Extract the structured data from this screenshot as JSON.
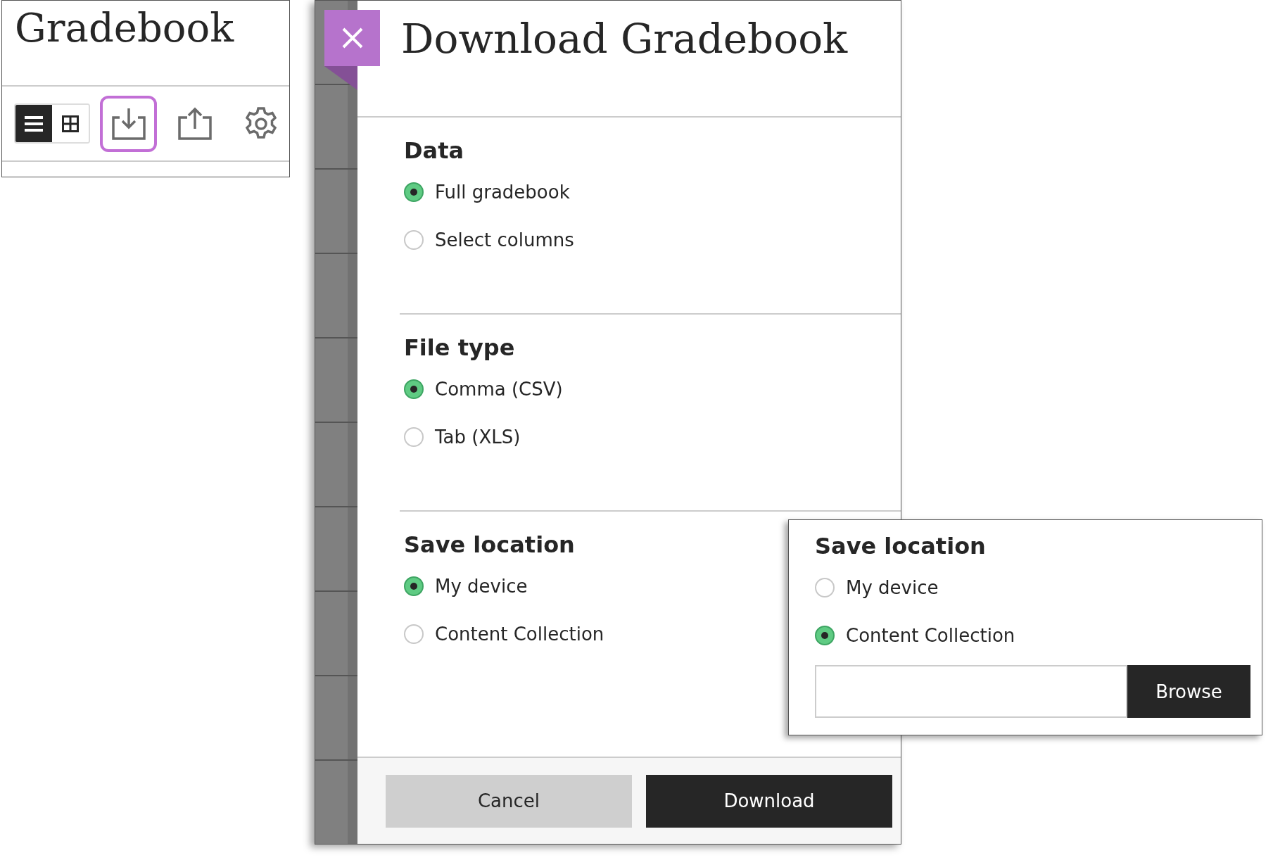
{
  "gradebook": {
    "title": "Gradebook",
    "view_toggle": [
      {
        "kind": "list",
        "selected": true
      },
      {
        "kind": "grid",
        "selected": false
      }
    ],
    "toolbar": [
      {
        "kind": "download",
        "highlighted": true
      },
      {
        "kind": "upload",
        "highlighted": false
      },
      {
        "kind": "settings",
        "highlighted": false
      }
    ]
  },
  "dialog": {
    "title": "Download Gradebook",
    "sections": [
      {
        "heading": "Data",
        "options": [
          {
            "label": "Full gradebook",
            "selected": true
          },
          {
            "label": "Select columns",
            "selected": false
          }
        ]
      },
      {
        "heading": "File type",
        "options": [
          {
            "label": "Comma (CSV)",
            "selected": true
          },
          {
            "label": "Tab (XLS)",
            "selected": false
          }
        ]
      },
      {
        "heading": "Save location",
        "options": [
          {
            "label": "My device",
            "selected": true
          },
          {
            "label": "Content Collection",
            "selected": false
          }
        ]
      }
    ],
    "buttons": [
      {
        "label": "Cancel",
        "kind": "secondary"
      },
      {
        "label": "Download",
        "kind": "primary"
      }
    ]
  },
  "save_location_inset": {
    "heading": "Save location",
    "options": [
      {
        "label": "My device",
        "selected": false
      },
      {
        "label": "Content Collection",
        "selected": true
      }
    ],
    "browse_button": "Browse"
  }
}
